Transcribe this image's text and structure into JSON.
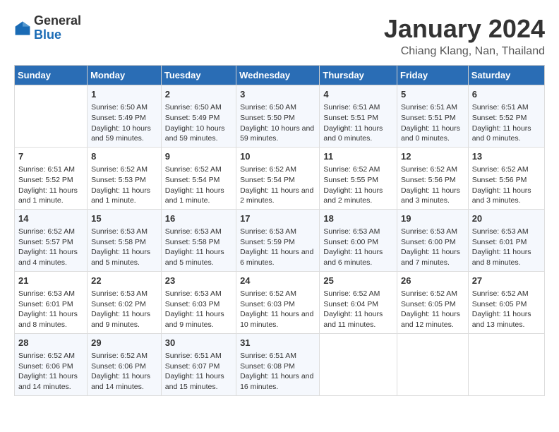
{
  "header": {
    "logo": {
      "general": "General",
      "blue": "Blue"
    },
    "title": "January 2024",
    "location": "Chiang Klang, Nan, Thailand"
  },
  "calendar": {
    "days_header": [
      "Sunday",
      "Monday",
      "Tuesday",
      "Wednesday",
      "Thursday",
      "Friday",
      "Saturday"
    ],
    "weeks": [
      [
        {
          "day": "",
          "sunrise": "",
          "sunset": "",
          "daylight": ""
        },
        {
          "day": "1",
          "sunrise": "Sunrise: 6:50 AM",
          "sunset": "Sunset: 5:49 PM",
          "daylight": "Daylight: 10 hours and 59 minutes."
        },
        {
          "day": "2",
          "sunrise": "Sunrise: 6:50 AM",
          "sunset": "Sunset: 5:49 PM",
          "daylight": "Daylight: 10 hours and 59 minutes."
        },
        {
          "day": "3",
          "sunrise": "Sunrise: 6:50 AM",
          "sunset": "Sunset: 5:50 PM",
          "daylight": "Daylight: 10 hours and 59 minutes."
        },
        {
          "day": "4",
          "sunrise": "Sunrise: 6:51 AM",
          "sunset": "Sunset: 5:51 PM",
          "daylight": "Daylight: 11 hours and 0 minutes."
        },
        {
          "day": "5",
          "sunrise": "Sunrise: 6:51 AM",
          "sunset": "Sunset: 5:51 PM",
          "daylight": "Daylight: 11 hours and 0 minutes."
        },
        {
          "day": "6",
          "sunrise": "Sunrise: 6:51 AM",
          "sunset": "Sunset: 5:52 PM",
          "daylight": "Daylight: 11 hours and 0 minutes."
        }
      ],
      [
        {
          "day": "7",
          "sunrise": "Sunrise: 6:51 AM",
          "sunset": "Sunset: 5:52 PM",
          "daylight": "Daylight: 11 hours and 1 minute."
        },
        {
          "day": "8",
          "sunrise": "Sunrise: 6:52 AM",
          "sunset": "Sunset: 5:53 PM",
          "daylight": "Daylight: 11 hours and 1 minute."
        },
        {
          "day": "9",
          "sunrise": "Sunrise: 6:52 AM",
          "sunset": "Sunset: 5:54 PM",
          "daylight": "Daylight: 11 hours and 1 minute."
        },
        {
          "day": "10",
          "sunrise": "Sunrise: 6:52 AM",
          "sunset": "Sunset: 5:54 PM",
          "daylight": "Daylight: 11 hours and 2 minutes."
        },
        {
          "day": "11",
          "sunrise": "Sunrise: 6:52 AM",
          "sunset": "Sunset: 5:55 PM",
          "daylight": "Daylight: 11 hours and 2 minutes."
        },
        {
          "day": "12",
          "sunrise": "Sunrise: 6:52 AM",
          "sunset": "Sunset: 5:56 PM",
          "daylight": "Daylight: 11 hours and 3 minutes."
        },
        {
          "day": "13",
          "sunrise": "Sunrise: 6:52 AM",
          "sunset": "Sunset: 5:56 PM",
          "daylight": "Daylight: 11 hours and 3 minutes."
        }
      ],
      [
        {
          "day": "14",
          "sunrise": "Sunrise: 6:52 AM",
          "sunset": "Sunset: 5:57 PM",
          "daylight": "Daylight: 11 hours and 4 minutes."
        },
        {
          "day": "15",
          "sunrise": "Sunrise: 6:53 AM",
          "sunset": "Sunset: 5:58 PM",
          "daylight": "Daylight: 11 hours and 5 minutes."
        },
        {
          "day": "16",
          "sunrise": "Sunrise: 6:53 AM",
          "sunset": "Sunset: 5:58 PM",
          "daylight": "Daylight: 11 hours and 5 minutes."
        },
        {
          "day": "17",
          "sunrise": "Sunrise: 6:53 AM",
          "sunset": "Sunset: 5:59 PM",
          "daylight": "Daylight: 11 hours and 6 minutes."
        },
        {
          "day": "18",
          "sunrise": "Sunrise: 6:53 AM",
          "sunset": "Sunset: 6:00 PM",
          "daylight": "Daylight: 11 hours and 6 minutes."
        },
        {
          "day": "19",
          "sunrise": "Sunrise: 6:53 AM",
          "sunset": "Sunset: 6:00 PM",
          "daylight": "Daylight: 11 hours and 7 minutes."
        },
        {
          "day": "20",
          "sunrise": "Sunrise: 6:53 AM",
          "sunset": "Sunset: 6:01 PM",
          "daylight": "Daylight: 11 hours and 8 minutes."
        }
      ],
      [
        {
          "day": "21",
          "sunrise": "Sunrise: 6:53 AM",
          "sunset": "Sunset: 6:01 PM",
          "daylight": "Daylight: 11 hours and 8 minutes."
        },
        {
          "day": "22",
          "sunrise": "Sunrise: 6:53 AM",
          "sunset": "Sunset: 6:02 PM",
          "daylight": "Daylight: 11 hours and 9 minutes."
        },
        {
          "day": "23",
          "sunrise": "Sunrise: 6:53 AM",
          "sunset": "Sunset: 6:03 PM",
          "daylight": "Daylight: 11 hours and 9 minutes."
        },
        {
          "day": "24",
          "sunrise": "Sunrise: 6:52 AM",
          "sunset": "Sunset: 6:03 PM",
          "daylight": "Daylight: 11 hours and 10 minutes."
        },
        {
          "day": "25",
          "sunrise": "Sunrise: 6:52 AM",
          "sunset": "Sunset: 6:04 PM",
          "daylight": "Daylight: 11 hours and 11 minutes."
        },
        {
          "day": "26",
          "sunrise": "Sunrise: 6:52 AM",
          "sunset": "Sunset: 6:05 PM",
          "daylight": "Daylight: 11 hours and 12 minutes."
        },
        {
          "day": "27",
          "sunrise": "Sunrise: 6:52 AM",
          "sunset": "Sunset: 6:05 PM",
          "daylight": "Daylight: 11 hours and 13 minutes."
        }
      ],
      [
        {
          "day": "28",
          "sunrise": "Sunrise: 6:52 AM",
          "sunset": "Sunset: 6:06 PM",
          "daylight": "Daylight: 11 hours and 14 minutes."
        },
        {
          "day": "29",
          "sunrise": "Sunrise: 6:52 AM",
          "sunset": "Sunset: 6:06 PM",
          "daylight": "Daylight: 11 hours and 14 minutes."
        },
        {
          "day": "30",
          "sunrise": "Sunrise: 6:51 AM",
          "sunset": "Sunset: 6:07 PM",
          "daylight": "Daylight: 11 hours and 15 minutes."
        },
        {
          "day": "31",
          "sunrise": "Sunrise: 6:51 AM",
          "sunset": "Sunset: 6:08 PM",
          "daylight": "Daylight: 11 hours and 16 minutes."
        },
        {
          "day": "",
          "sunrise": "",
          "sunset": "",
          "daylight": ""
        },
        {
          "day": "",
          "sunrise": "",
          "sunset": "",
          "daylight": ""
        },
        {
          "day": "",
          "sunrise": "",
          "sunset": "",
          "daylight": ""
        }
      ]
    ]
  }
}
